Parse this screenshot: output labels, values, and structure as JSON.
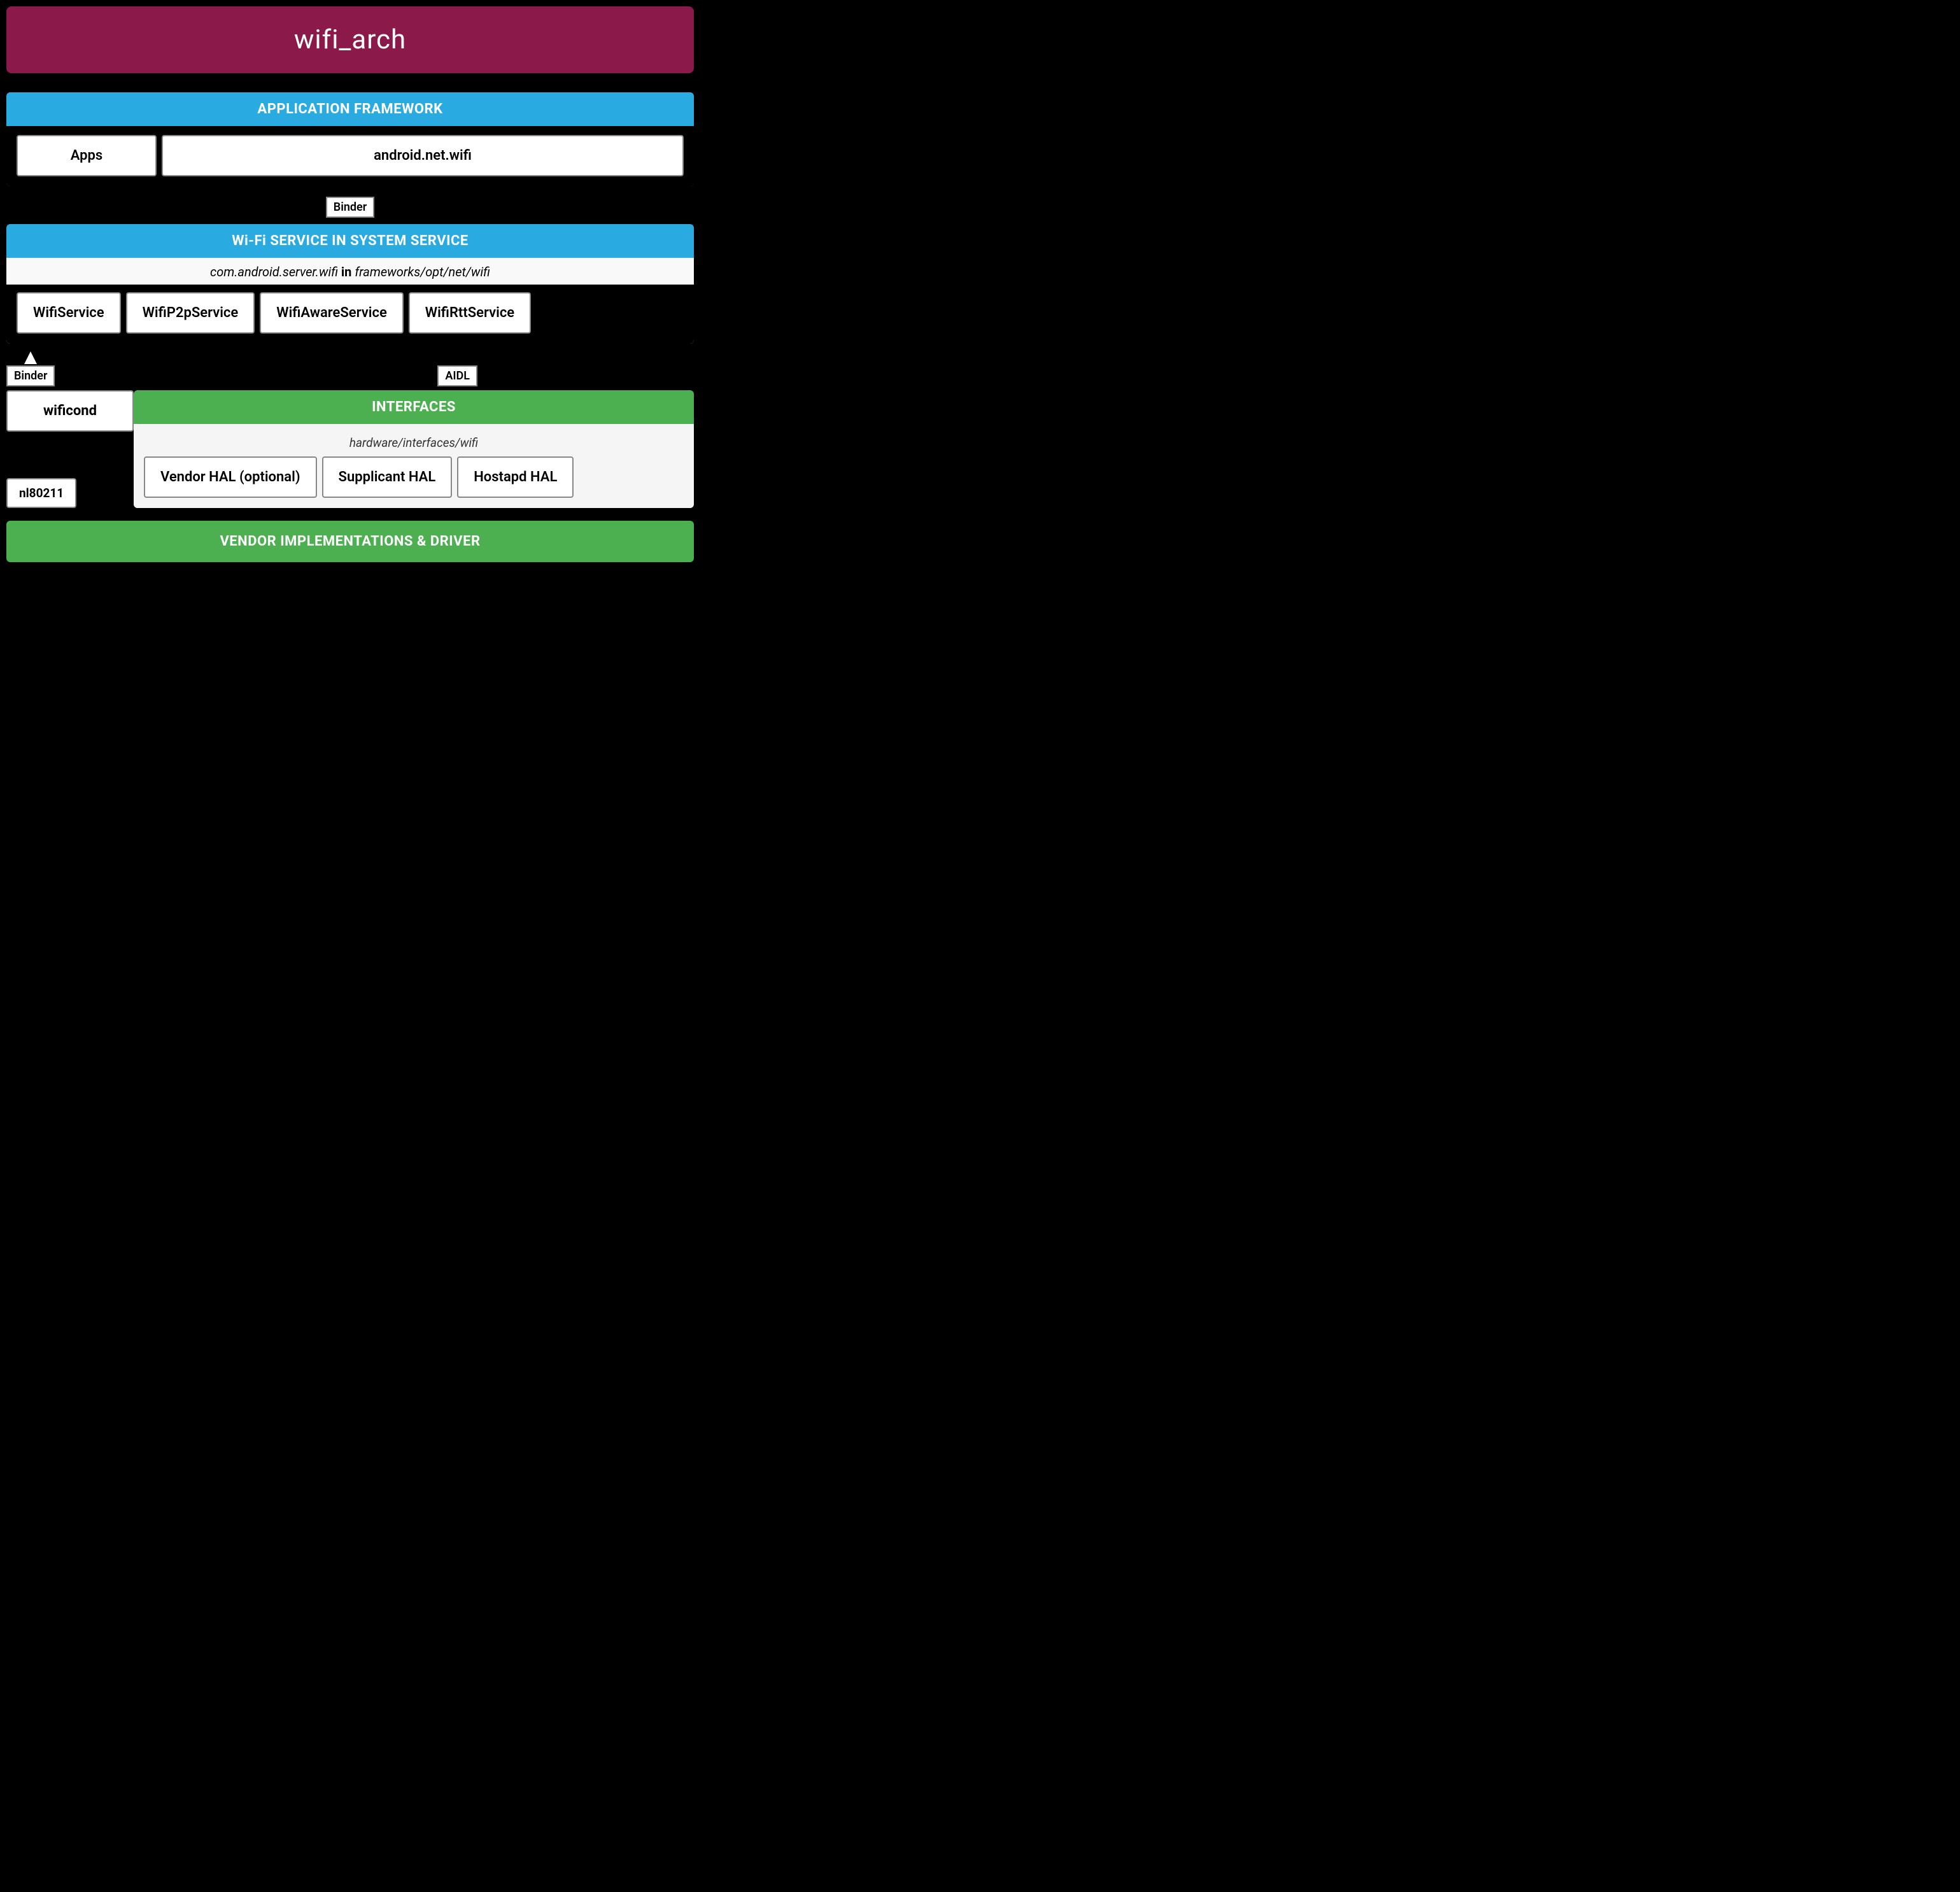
{
  "title": "wifi_arch",
  "title_bg": "#8B1A4A",
  "app_framework": {
    "header": "APPLICATION FRAMEWORK",
    "items": [
      {
        "label": "Apps"
      },
      {
        "label": "android.net.wifi"
      }
    ]
  },
  "binder_top": "Binder",
  "wifi_service": {
    "header": "Wi-Fi SERVICE IN SYSTEM SERVICE",
    "subtitle_pre": "com.android.server.wifi",
    "subtitle_in": "in",
    "subtitle_post": "frameworks/opt/net/wifi",
    "services": [
      {
        "label": "WifiService"
      },
      {
        "label": "WifiP2pService"
      },
      {
        "label": "WifiAwareService"
      },
      {
        "label": "WifiRttService"
      }
    ]
  },
  "binder_left": "Binder",
  "aidl_label": "AIDL",
  "wificond_label": "wificond",
  "nl80211_label": "nl80211",
  "interfaces": {
    "header": "INTERFACES",
    "subtitle": "hardware/interfaces/wifi",
    "items": [
      {
        "label": "Vendor HAL (optional)"
      },
      {
        "label": "Supplicant HAL"
      },
      {
        "label": "Hostapd HAL"
      }
    ]
  },
  "vendor_bar": "VENDOR IMPLEMENTATIONS & DRIVER"
}
